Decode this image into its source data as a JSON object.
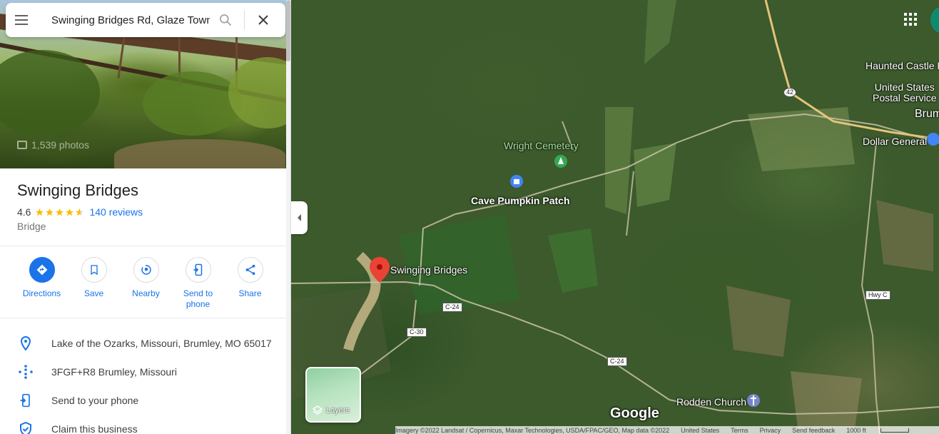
{
  "search": {
    "value": "Swinging Bridges Rd, Glaze Town"
  },
  "hero": {
    "photos_label": "1,539 photos"
  },
  "place": {
    "title": "Swinging Bridges",
    "rating": "4.6",
    "rating_stars": 4.6,
    "reviews": "140 reviews",
    "category": "Bridge"
  },
  "actions": [
    {
      "label": "Directions",
      "icon": "directions-icon"
    },
    {
      "label": "Save",
      "icon": "bookmark-icon"
    },
    {
      "label": "Nearby",
      "icon": "nearby-icon"
    },
    {
      "label": "Send to\nphone",
      "icon": "send-to-phone-icon"
    },
    {
      "label": "Share",
      "icon": "share-icon"
    }
  ],
  "info": {
    "address": "Lake of the Ozarks, Missouri, Brumley, MO 65017",
    "plus_code": "3FGF+R8 Brumley, Missouri",
    "send_phone": "Send to your phone",
    "claim": "Claim this business"
  },
  "map": {
    "labels": {
      "wright_cemetery": "Wright Cemetery",
      "cave_pumpkin_patch": "Cave Pumpkin Patch",
      "swinging_bridges": "Swinging Bridges",
      "haunted_castle": "Haunted Castle H",
      "usps": "United States\nPostal Service",
      "brum": "Brum",
      "dollar_general": "Dollar General",
      "rodden_church": "Rodden Church"
    },
    "shields": {
      "hwy42": "42",
      "c24a": "C-24",
      "c30": "C-30",
      "c24b": "C-24",
      "hwyc": "Hwy C"
    },
    "layers_label": "Layers",
    "google": "Google",
    "attribution": "Imagery ©2022 Landsat / Copernicus, Maxar Technologies, USDA/FPAC/GEO, Map data ©2022",
    "footer_links": [
      "United States",
      "Terms",
      "Privacy",
      "Send feedback"
    ],
    "scale": "1000 ft"
  },
  "colors": {
    "accent": "#1a73e8",
    "pin": "#ea4335",
    "star": "#fbbc04"
  }
}
